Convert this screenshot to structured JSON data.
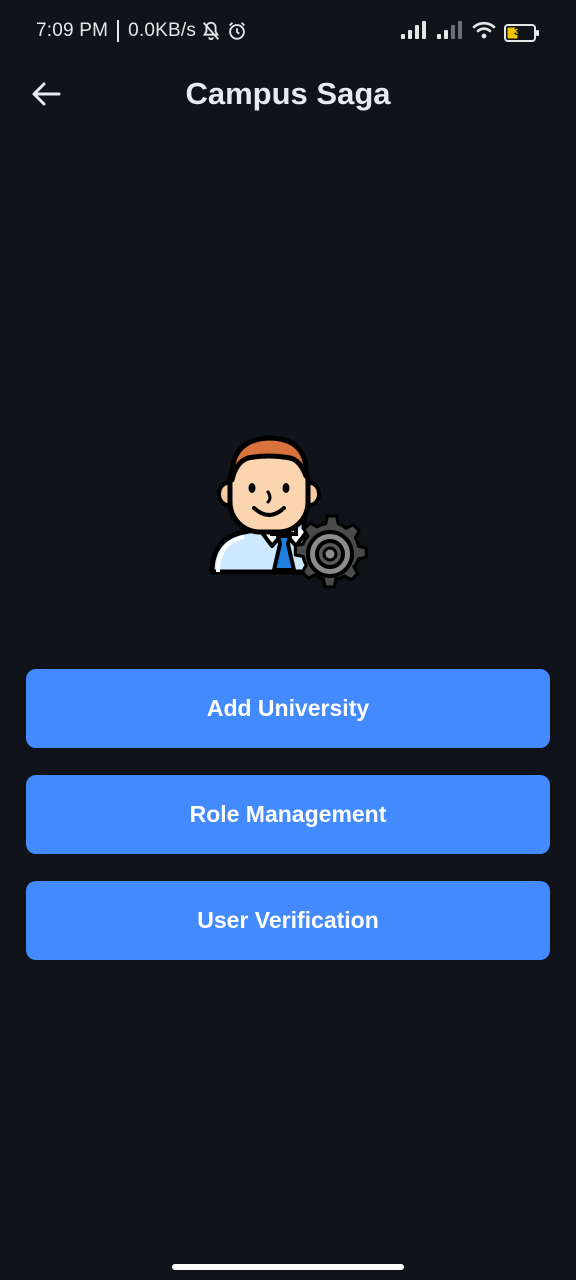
{
  "status_bar": {
    "time": "7:09 PM",
    "network_speed": "0.0KB/s",
    "battery_level": "31",
    "icons": [
      "notifications-off-icon",
      "alarm-icon",
      "signal-icon",
      "signal-icon-2",
      "wifi-icon",
      "battery-icon"
    ]
  },
  "app_bar": {
    "back_icon": "arrow-left-icon",
    "title": "Campus Saga"
  },
  "illustration": {
    "icon": "admin-user-gear-illustration"
  },
  "actions": [
    {
      "label": "Add University"
    },
    {
      "label": "Role Management"
    },
    {
      "label": "User Verification"
    }
  ],
  "colors": {
    "background": "#10131a",
    "button": "#448aff",
    "button_text": "#ffffff",
    "title": "#e8eaf0"
  }
}
